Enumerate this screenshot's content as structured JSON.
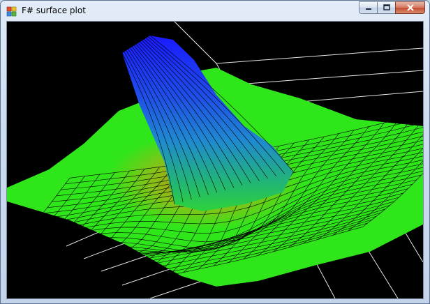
{
  "window": {
    "title": "F# surface plot",
    "app_icon": "windows-form-icon",
    "buttons": [
      {
        "name": "minimize",
        "icon": "minimize-icon"
      },
      {
        "name": "maximize",
        "icon": "maximize-icon"
      },
      {
        "name": "close",
        "icon": "close-icon"
      }
    ]
  },
  "plot": {
    "type": "3d-surface-wireframe",
    "background": "#000000",
    "grid_color": "#ffffff",
    "wire_color": "#000000",
    "colormap": [
      "#1a1aff",
      "#1f8ad0",
      "#22d23e",
      "#2fe61a",
      "#a08a10"
    ]
  }
}
